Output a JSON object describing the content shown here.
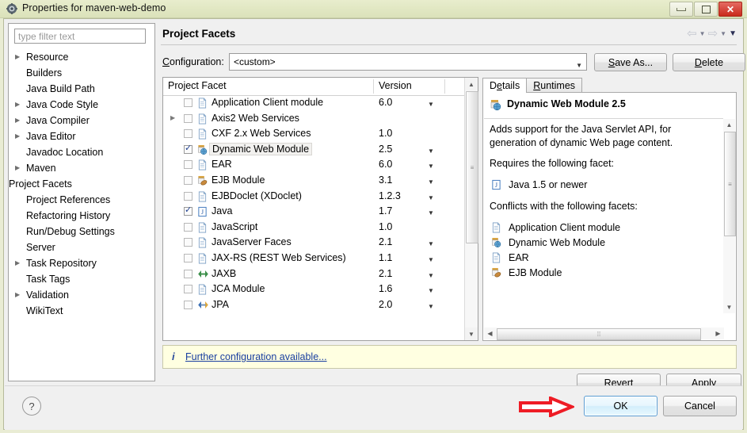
{
  "window": {
    "title": "Properties for maven-web-demo",
    "icon": "properties-gear-icon",
    "minimize": "minimize-icon",
    "maximize": "maximize-icon",
    "close": "close-icon"
  },
  "sidebar": {
    "filter_placeholder": "type filter text",
    "items": [
      {
        "label": "Resource",
        "expandable": true
      },
      {
        "label": "Builders",
        "expandable": false
      },
      {
        "label": "Java Build Path",
        "expandable": false
      },
      {
        "label": "Java Code Style",
        "expandable": true
      },
      {
        "label": "Java Compiler",
        "expandable": true
      },
      {
        "label": "Java Editor",
        "expandable": true
      },
      {
        "label": "Javadoc Location",
        "expandable": false
      },
      {
        "label": "Maven",
        "expandable": true
      },
      {
        "label": "Project Facets",
        "expandable": false,
        "selected": true
      },
      {
        "label": "Project References",
        "expandable": false
      },
      {
        "label": "Refactoring History",
        "expandable": false
      },
      {
        "label": "Run/Debug Settings",
        "expandable": false
      },
      {
        "label": "Server",
        "expandable": false
      },
      {
        "label": "Task Repository",
        "expandable": true
      },
      {
        "label": "Task Tags",
        "expandable": false
      },
      {
        "label": "Validation",
        "expandable": true
      },
      {
        "label": "WikiText",
        "expandable": false
      }
    ]
  },
  "page": {
    "title": "Project Facets",
    "nav": {
      "back": "back-arrow-icon",
      "forward": "forward-arrow-icon",
      "menu": "dropdown-caret-icon"
    }
  },
  "configuration": {
    "label": "Configuration:",
    "value": "<custom>",
    "save_as_label": "Save As...",
    "delete_label": "Delete"
  },
  "facet_table": {
    "columns": [
      "Project Facet",
      "Version"
    ],
    "rows": [
      {
        "name": "Application Client module",
        "version": "6.0",
        "checked": false,
        "expandable": false,
        "has_dropdown": true,
        "icon": "document-icon"
      },
      {
        "name": "Axis2 Web Services",
        "version": "",
        "checked": false,
        "expandable": true,
        "has_dropdown": false,
        "icon": "document-icon"
      },
      {
        "name": "CXF 2.x Web Services",
        "version": "1.0",
        "checked": false,
        "expandable": false,
        "has_dropdown": false,
        "icon": "document-icon"
      },
      {
        "name": "Dynamic Web Module",
        "version": "2.5",
        "checked": true,
        "expandable": false,
        "has_dropdown": true,
        "icon": "web-module-icon",
        "selected": true
      },
      {
        "name": "EAR",
        "version": "6.0",
        "checked": false,
        "expandable": false,
        "has_dropdown": true,
        "icon": "document-icon"
      },
      {
        "name": "EJB Module",
        "version": "3.1",
        "checked": false,
        "expandable": false,
        "has_dropdown": true,
        "icon": "ejb-module-icon"
      },
      {
        "name": "EJBDoclet (XDoclet)",
        "version": "1.2.3",
        "checked": false,
        "expandable": false,
        "has_dropdown": true,
        "icon": "document-icon"
      },
      {
        "name": "Java",
        "version": "1.7",
        "checked": true,
        "expandable": false,
        "has_dropdown": true,
        "icon": "java-icon"
      },
      {
        "name": "JavaScript",
        "version": "1.0",
        "checked": false,
        "expandable": false,
        "has_dropdown": false,
        "icon": "document-icon"
      },
      {
        "name": "JavaServer Faces",
        "version": "2.1",
        "checked": false,
        "expandable": false,
        "has_dropdown": true,
        "icon": "document-icon"
      },
      {
        "name": "JAX-RS (REST Web Services)",
        "version": "1.1",
        "checked": false,
        "expandable": false,
        "has_dropdown": true,
        "icon": "document-icon"
      },
      {
        "name": "JAXB",
        "version": "2.1",
        "checked": false,
        "expandable": false,
        "has_dropdown": true,
        "icon": "jaxb-icon"
      },
      {
        "name": "JCA Module",
        "version": "1.6",
        "checked": false,
        "expandable": false,
        "has_dropdown": true,
        "icon": "document-icon"
      },
      {
        "name": "JPA",
        "version": "2.0",
        "checked": false,
        "expandable": false,
        "has_dropdown": true,
        "icon": "jpa-icon"
      }
    ]
  },
  "details": {
    "tabs": [
      {
        "label": "Details",
        "active": true
      },
      {
        "label": "Runtimes",
        "active": false
      }
    ],
    "heading": "Dynamic Web Module 2.5",
    "heading_icon": "web-module-icon",
    "description": "Adds support for the Java Servlet API, for generation of dynamic Web page content.",
    "requires_label": "Requires the following facet:",
    "requires": [
      {
        "label": "Java 1.5 or newer",
        "icon": "java-icon"
      }
    ],
    "conflicts_label": "Conflicts with the following facets:",
    "conflicts": [
      {
        "label": "Application Client module",
        "icon": "document-icon"
      },
      {
        "label": "Dynamic Web Module",
        "icon": "web-module-icon"
      },
      {
        "label": "EAR",
        "icon": "document-icon"
      },
      {
        "label": "EJB Module",
        "icon": "ejb-module-icon"
      }
    ]
  },
  "info_bar": {
    "icon": "info-icon",
    "link": "Further configuration available..."
  },
  "buttons": {
    "revert": "Revert",
    "apply": "Apply",
    "ok": "OK",
    "cancel": "Cancel",
    "help": "?"
  },
  "annotation": {
    "arrow": "red-arrow-annotation",
    "color": "#ee1c25"
  }
}
